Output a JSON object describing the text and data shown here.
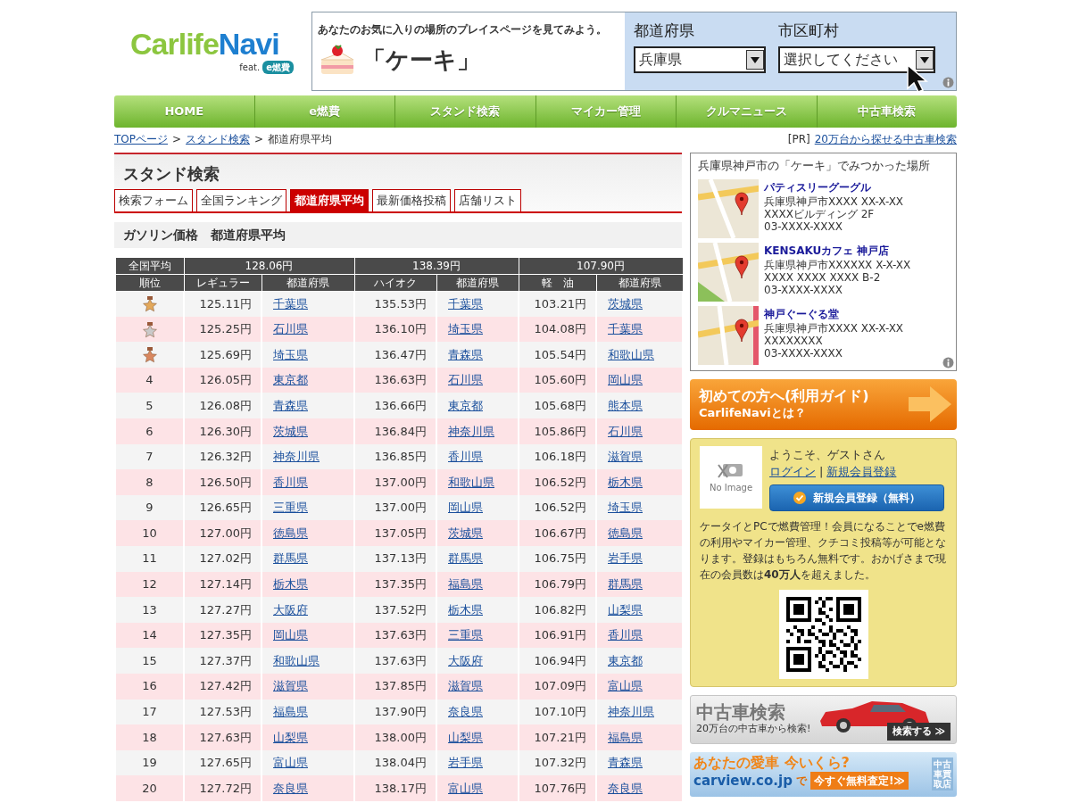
{
  "logo": {
    "parts": [
      {
        "text": "Carlife",
        "color": "#8cc63f"
      },
      {
        "text": "Navi",
        "color": "#1e7fd0"
      }
    ],
    "feat": "feat.",
    "badge": "e燃費"
  },
  "header_ad": {
    "prompt": "あなたのお気に入りの場所のプレイスページを見てみよう。",
    "keyword": "「ケーキ」",
    "prefecture_label": "都道府県",
    "prefecture_value": "兵庫県",
    "city_label": "市区町村",
    "city_value": "選択してください"
  },
  "nav": [
    "HOME",
    "e燃費",
    "スタンド検索",
    "マイカー管理",
    "クルマニュース",
    "中古車検索"
  ],
  "breadcrumb": {
    "separator": ">",
    "items": [
      {
        "text": "TOPページ",
        "link": true
      },
      {
        "text": "スタンド検索",
        "link": true
      },
      {
        "text": "都道府県平均",
        "link": false
      }
    ]
  },
  "pr": {
    "tag": "[PR]",
    "link": "20万台から探せる中古車検索"
  },
  "section": {
    "title": "スタンド検索",
    "tabs": [
      {
        "label": "検索フォーム",
        "selected": false
      },
      {
        "label": "全国ランキング",
        "selected": false
      },
      {
        "label": "都道府県平均",
        "selected": true
      },
      {
        "label": "最新価格投稿",
        "selected": false
      },
      {
        "label": "店舗リスト",
        "selected": false
      }
    ],
    "subtitle": "ガソリン価格　都道府県平均"
  },
  "table": {
    "average_label": "全国平均",
    "averages": [
      "128.06円",
      "138.39円",
      "107.90円"
    ],
    "columns": [
      "順位",
      "レギュラー",
      "都道府県",
      "ハイオク",
      "都道府県",
      "軽　油",
      "都道府県"
    ],
    "rows": [
      {
        "kind": "gold",
        "cells": [
          "",
          "125.11円",
          "千葉県",
          "135.53円",
          "千葉県",
          "103.21円",
          "茨城県"
        ]
      },
      {
        "kind": "silver",
        "cells": [
          "",
          "125.25円",
          "石川県",
          "136.10円",
          "埼玉県",
          "104.08円",
          "千葉県"
        ]
      },
      {
        "kind": "bronze",
        "cells": [
          "",
          "125.69円",
          "埼玉県",
          "136.47円",
          "青森県",
          "105.54円",
          "和歌山県"
        ]
      },
      {
        "cells": [
          "4",
          "126.05円",
          "東京都",
          "136.63円",
          "石川県",
          "105.60円",
          "岡山県"
        ]
      },
      {
        "cells": [
          "5",
          "126.08円",
          "青森県",
          "136.66円",
          "東京都",
          "105.68円",
          "熊本県"
        ]
      },
      {
        "cells": [
          "6",
          "126.30円",
          "茨城県",
          "136.84円",
          "神奈川県",
          "105.86円",
          "石川県"
        ]
      },
      {
        "cells": [
          "7",
          "126.32円",
          "神奈川県",
          "136.85円",
          "香川県",
          "106.18円",
          "滋賀県"
        ]
      },
      {
        "cells": [
          "8",
          "126.50円",
          "香川県",
          "137.00円",
          "和歌山県",
          "106.52円",
          "栃木県"
        ]
      },
      {
        "cells": [
          "9",
          "126.65円",
          "三重県",
          "137.00円",
          "岡山県",
          "106.52円",
          "埼玉県"
        ]
      },
      {
        "cells": [
          "10",
          "127.00円",
          "徳島県",
          "137.05円",
          "茨城県",
          "106.67円",
          "徳島県"
        ]
      },
      {
        "cells": [
          "11",
          "127.02円",
          "群馬県",
          "137.13円",
          "群馬県",
          "106.75円",
          "岩手県"
        ]
      },
      {
        "cells": [
          "12",
          "127.14円",
          "栃木県",
          "137.35円",
          "福島県",
          "106.79円",
          "群馬県"
        ]
      },
      {
        "cells": [
          "13",
          "127.27円",
          "大阪府",
          "137.52円",
          "栃木県",
          "106.82円",
          "山梨県"
        ]
      },
      {
        "cells": [
          "14",
          "127.35円",
          "岡山県",
          "137.63円",
          "三重県",
          "106.91円",
          "香川県"
        ]
      },
      {
        "cells": [
          "15",
          "127.37円",
          "和歌山県",
          "137.63円",
          "大阪府",
          "106.94円",
          "東京都"
        ]
      },
      {
        "cells": [
          "16",
          "127.42円",
          "滋賀県",
          "137.85円",
          "滋賀県",
          "107.09円",
          "富山県"
        ]
      },
      {
        "cells": [
          "17",
          "127.53円",
          "福島県",
          "137.90円",
          "奈良県",
          "107.10円",
          "神奈川県"
        ]
      },
      {
        "cells": [
          "18",
          "127.63円",
          "山梨県",
          "138.00円",
          "山梨県",
          "107.21円",
          "福島県"
        ]
      },
      {
        "cells": [
          "19",
          "127.65円",
          "富山県",
          "138.04円",
          "岩手県",
          "107.32円",
          "青森県"
        ]
      },
      {
        "cells": [
          "20",
          "127.72円",
          "奈良県",
          "138.17円",
          "富山県",
          "107.76円",
          "奈良県"
        ]
      }
    ]
  },
  "places_ad": {
    "title": "兵庫県神戸市の「ケーキ」でみつかった場所",
    "places": [
      {
        "name": "パティスリーグーグル",
        "lines": [
          "兵庫県神戸市XXXX XX-X-XX",
          "XXXXビルディング 2F",
          "03-XXXX-XXXX"
        ]
      },
      {
        "name": "KENSAKUカフェ 神戸店",
        "lines": [
          "兵庫県神戸市XXXXXX X-X-XX",
          "XXXX XXXX XXXX B-2",
          "03-XXXX-XXXX"
        ]
      },
      {
        "name": "神戸ぐーぐる堂",
        "lines": [
          "兵庫県神戸市XXXX XX-X-XX",
          "XXXXXXXX",
          "03-XXXX-XXXX"
        ]
      }
    ]
  },
  "guide_banner": {
    "title": "初めての方へ(利用ガイド)",
    "subtitle": "CarlifeNaviとは？"
  },
  "member": {
    "no_image": "No Image",
    "greeting": "ようこそ、ゲストさん",
    "login": "ログイン",
    "separator": "|",
    "register_link": "新規会員登録",
    "register_button": "新規会員登録（無料）",
    "description": "ケータイとPCで燃費管理！会員になることでe燃費の利用やマイカー管理、クチコミ投稿等が可能となります。登録はもちろん無料です。おかげさまで現在の会員数は**40万人**を超えました。"
  },
  "used_car_banner": {
    "title": "中古車検索",
    "subtitle": "20万台の中古車から検索!",
    "button": "検索する ≫"
  },
  "carview_banner": {
    "title": "あなたの愛車 今いくら?",
    "site": "carview.co.jp",
    "particle": "で",
    "button": "今すぐ無料査定!≫",
    "sign": "中古車買取店"
  }
}
